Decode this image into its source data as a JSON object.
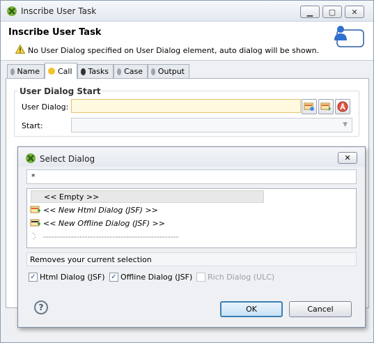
{
  "window": {
    "title": "Inscribe User Task",
    "minimize_icon": "minimize-icon",
    "maximize_icon": "maximize-icon",
    "close_icon": "close-icon"
  },
  "header": {
    "title": "Inscribe User Task",
    "warning_message": "No User Dialog specified on User Dialog element, auto dialog will be shown.",
    "warning_icon": "warning-icon",
    "element_icon": "user-task-icon"
  },
  "tabs": [
    {
      "label": "Name",
      "icon": "status-dot-icon",
      "color": "#9ca3ad",
      "active": false
    },
    {
      "label": "Call",
      "icon": "status-dot-icon",
      "color": "#f2c230",
      "active": true
    },
    {
      "label": "Tasks",
      "icon": "status-dot-icon",
      "color": "#333333",
      "active": false
    },
    {
      "label": "Case",
      "icon": "status-dot-icon",
      "color": "#9ca3ad",
      "active": false
    },
    {
      "label": "Output",
      "icon": "status-dot-icon",
      "color": "#9ca3ad",
      "active": false
    }
  ],
  "call": {
    "group_title": "User Dialog Start",
    "user_dialog_label": "User Dialog:",
    "user_dialog_value": "",
    "start_label": "Start:",
    "start_value": "",
    "buttons": [
      "browse-dialog-icon",
      "new-dialog-icon",
      "ai-icon"
    ]
  },
  "dialog": {
    "title": "Select Dialog",
    "filter_value": "*",
    "items": [
      {
        "label": "<< Empty >>",
        "icon": ""
      },
      {
        "label": "<< New Html Dialog (JSF) >>",
        "icon": "new-html-dialog-icon"
      },
      {
        "label": "<< New Offline Dialog (JSF) >>",
        "icon": "new-offline-dialog-icon"
      },
      {
        "label": "-------------------------------------------------",
        "icon": "loading-icon"
      }
    ],
    "description": "Removes your current selection",
    "checkboxes": [
      {
        "label": "Html Dialog (JSF)",
        "checked": true,
        "enabled": true
      },
      {
        "label": "Offline Dialog (JSF)",
        "checked": true,
        "enabled": true
      },
      {
        "label": "Rich Dialog (ULC)",
        "checked": false,
        "enabled": false
      }
    ],
    "help_label": "?",
    "ok_label": "OK",
    "cancel_label": "Cancel"
  }
}
